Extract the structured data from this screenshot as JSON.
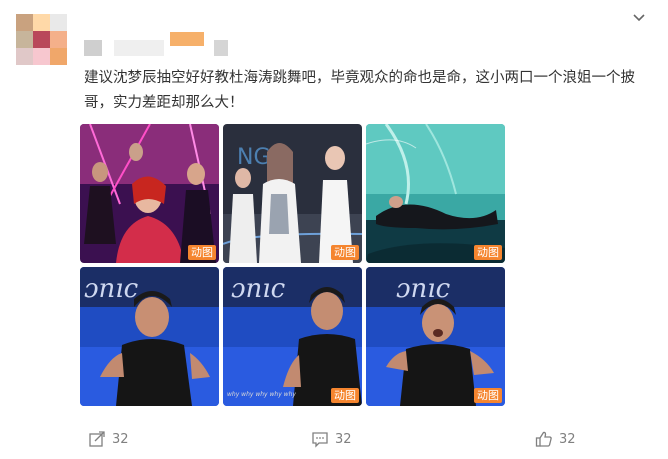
{
  "post": {
    "avatar_colors": [
      "#c9a27f",
      "#ffd9a8",
      "#e9e9e9",
      "#c7b59b",
      "#b9485a",
      "#f4b08a",
      "#e0c8c8",
      "#f7c7cf",
      "#f0a76a"
    ],
    "username_blur_colors": [
      "#c8c8c8",
      "#f5b36d",
      "#d9d9d9"
    ],
    "text": "建议沈梦辰抽空好好教杜海涛跳舞吧，毕竟观众的命也是命，这小两口一个浪姐一个披哥，实力差距却那么大！",
    "images": [
      {
        "badge": "动图",
        "subtitle": "",
        "scene": "stage-red"
      },
      {
        "badge": "动图",
        "subtitle": "",
        "scene": "stage-white"
      },
      {
        "badge": "动图",
        "subtitle": "",
        "scene": "stage-teal"
      },
      {
        "badge": "",
        "subtitle": "",
        "scene": "dance-blue"
      },
      {
        "badge": "动图",
        "subtitle": "why why why why why",
        "scene": "dance-blue"
      },
      {
        "badge": "动图",
        "subtitle": "",
        "scene": "dance-blue"
      }
    ]
  },
  "actions": {
    "share_count": "32",
    "comment_count": "32",
    "like_count": "32"
  }
}
